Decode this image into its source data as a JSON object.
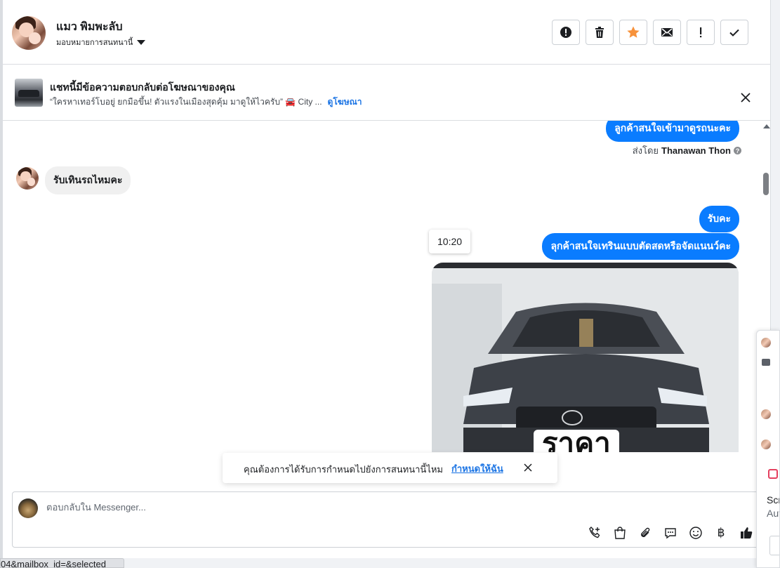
{
  "header": {
    "contact_name": "แมว พิมพะลับ",
    "assign_label": "มอบหมายการสนทนานี้",
    "actions": [
      {
        "name": "spam-button",
        "icon": "alert-circle-icon"
      },
      {
        "name": "delete-button",
        "icon": "trash-icon"
      },
      {
        "name": "star-button",
        "icon": "star-icon"
      },
      {
        "name": "mark-unread-button",
        "icon": "envelope-icon"
      },
      {
        "name": "follow-up-button",
        "icon": "exclamation-icon"
      },
      {
        "name": "mark-done-button",
        "icon": "check-icon"
      }
    ],
    "star_color": "#f7923b"
  },
  "ad_banner": {
    "title": "แชทนี้มีข้อความตอบกลับต่อโฆษณาของคุณ",
    "ad_text": "“ใครหาเทอร์โบอยู่ ยกมือขึ้น! ตัวแรงในเมืองสุดคุ้ม มาดูให้ไวครับ” 🚘 City ...",
    "view_ad_link": "ดูโฆษณา"
  },
  "messages": {
    "out_1": "ลูกค้าสนใจเข้ามาดูรถนะคะ",
    "sent_by_label": "ส่งโดย",
    "sent_by_name": "Thanawan Thon",
    "in_1": "รับเทินรถไหมคะ",
    "out_2": "รับคะ",
    "out_3": "ลุกค้าสนใจเทรินแบบตัดสดหรือจัดแนนว์คะ",
    "timestamp": "10:20",
    "image_caption_text": "ราคา"
  },
  "toast": {
    "text": "คุณต้องการได้รับการกำหนดไปยังการสนทนานี้ไหม",
    "link": "กำหนดให้ฉัน"
  },
  "composer": {
    "placeholder": "ตอบกลับใน Messenger...",
    "tools": [
      "call-add-icon",
      "shopping-bag-icon",
      "paperclip-icon",
      "saved-reply-icon",
      "emoji-icon",
      "baht-icon",
      "thumbs-up-icon"
    ]
  },
  "side_popup": {
    "line1": "Scr",
    "line2": "Aut"
  },
  "status_url": "04&mailbox_id=&selected",
  "colors": {
    "accent": "#0a7cff",
    "link": "#1b74e4"
  }
}
